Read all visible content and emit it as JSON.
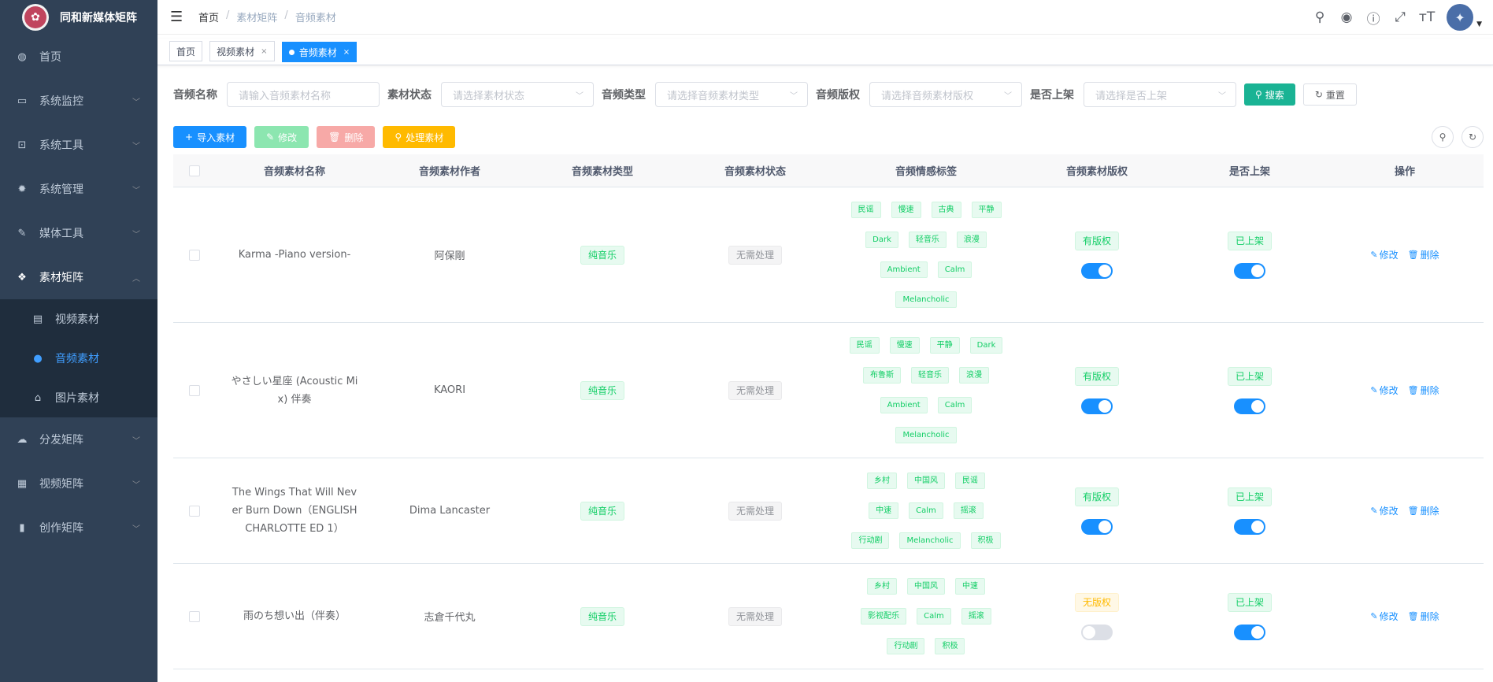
{
  "app": {
    "title": "同和新媒体矩阵"
  },
  "sidebar": {
    "items": [
      {
        "label": "首页",
        "icon": "dashboard-icon"
      },
      {
        "label": "系统监控",
        "icon": "monitor-icon"
      },
      {
        "label": "系统工具",
        "icon": "tool-icon"
      },
      {
        "label": "系统管理",
        "icon": "system-icon"
      },
      {
        "label": "媒体工具",
        "icon": "edit-icon"
      },
      {
        "label": "素材矩阵",
        "icon": "material-icon"
      },
      {
        "label": "分发矩阵",
        "icon": "upload-icon"
      },
      {
        "label": "视频矩阵",
        "icon": "video-matrix-icon"
      },
      {
        "label": "创作矩阵",
        "icon": "create-icon"
      }
    ],
    "submenu": [
      {
        "label": "视频素材",
        "icon": "document-icon"
      },
      {
        "label": "音频素材",
        "icon": "wechat-icon"
      },
      {
        "label": "图片素材",
        "icon": "image-icon"
      }
    ]
  },
  "header": {
    "breadcrumb": [
      "首页",
      "素材矩阵",
      "音频素材"
    ]
  },
  "tags_view": {
    "tags": [
      "首页",
      "视频素材",
      "音频素材"
    ]
  },
  "search": {
    "name_label": "音频名称",
    "name_placeholder": "请输入音频素材名称",
    "status_label": "素材状态",
    "status_placeholder": "请选择素材状态",
    "type_label": "音频类型",
    "type_placeholder": "请选择音频素材类型",
    "copyright_label": "音频版权",
    "copyright_placeholder": "请选择音频素材版权",
    "listed_label": "是否上架",
    "listed_placeholder": "请选择是否上架",
    "search_btn": "搜索",
    "reset_btn": "重置"
  },
  "toolbar": {
    "import": "导入素材",
    "edit": "修改",
    "delete": "删除",
    "process": "处理素材"
  },
  "table": {
    "headers": [
      "音频素材名称",
      "音频素材作者",
      "音频素材类型",
      "音频素材状态",
      "音频情感标签",
      "音频素材版权",
      "是否上架",
      "操作"
    ],
    "edit_label": "修改",
    "delete_label": "删除",
    "rows": [
      {
        "name": "Karma -Piano version-",
        "author": "阿保剛",
        "type": "纯音乐",
        "status": "无需处理",
        "emotion_lines": [
          [
            "民谣",
            "慢速",
            "古典",
            "平静"
          ],
          [
            "Dark",
            "轻音乐",
            "浪漫"
          ],
          [
            "Ambient",
            "Calm"
          ],
          [
            "Melancholic"
          ]
        ],
        "copyright": "有版权",
        "copyright_on": true,
        "listed": "已上架",
        "listed_on": true
      },
      {
        "name": "やさしい星座 (Acoustic Mix) 伴奏",
        "author": "KAORI",
        "type": "纯音乐",
        "status": "无需处理",
        "emotion_lines": [
          [
            "民谣",
            "慢速",
            "平静",
            "Dark"
          ],
          [
            "布鲁斯",
            "轻音乐",
            "浪漫"
          ],
          [
            "Ambient",
            "Calm"
          ],
          [
            "Melancholic"
          ]
        ],
        "copyright": "有版权",
        "copyright_on": true,
        "listed": "已上架",
        "listed_on": true
      },
      {
        "name": "The Wings That Will Never Burn Down（ENGLISH CHARLOTTE ED 1）",
        "author": "Dima Lancaster",
        "type": "纯音乐",
        "status": "无需处理",
        "emotion_lines": [
          [
            "乡村",
            "中国风",
            "民谣"
          ],
          [
            "中速",
            "Calm",
            "摇滚"
          ],
          [
            "行动剧",
            "Melancholic",
            "积极"
          ]
        ],
        "copyright": "有版权",
        "copyright_on": true,
        "listed": "已上架",
        "listed_on": true
      },
      {
        "name": "雨のち想い出（伴奏）",
        "author": "志倉千代丸",
        "type": "纯音乐",
        "status": "无需处理",
        "emotion_lines": [
          [
            "乡村",
            "中国风",
            "中速"
          ],
          [
            "影视配乐",
            "Calm",
            "摇滚"
          ],
          [
            "行动剧",
            "积极"
          ]
        ],
        "copyright": "无版权",
        "copyright_on": false,
        "listed": "已上架",
        "listed_on": true
      }
    ]
  }
}
